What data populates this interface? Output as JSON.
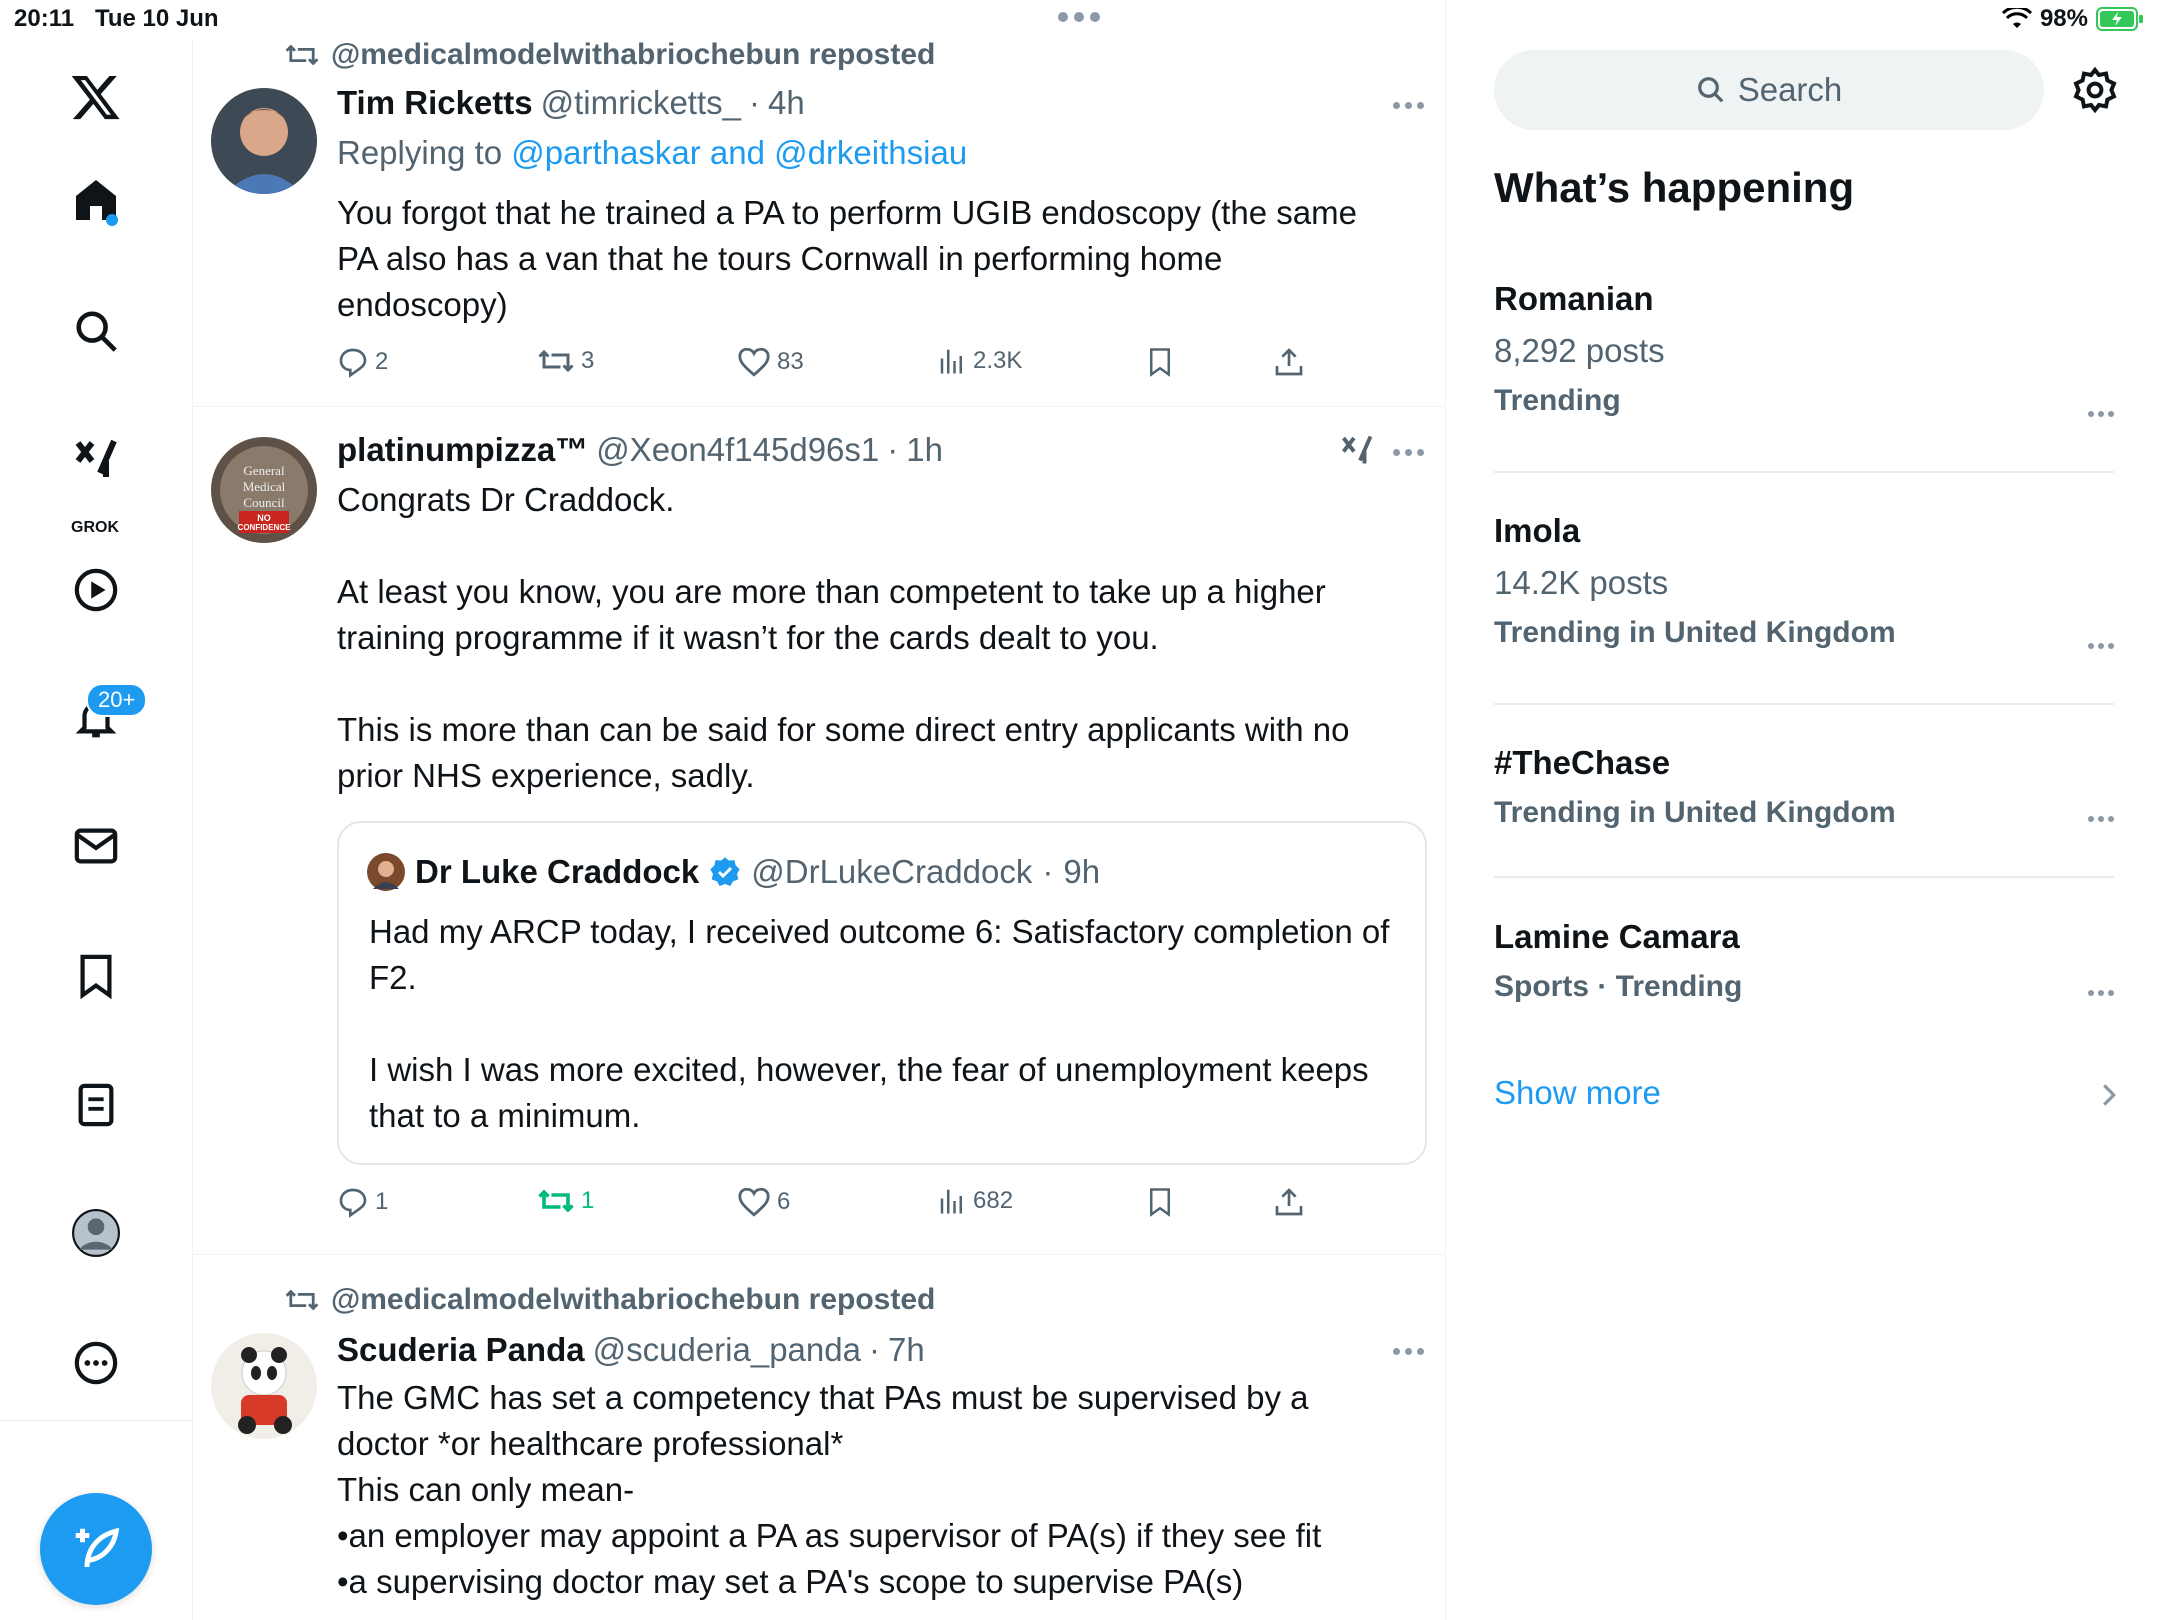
{
  "status_bar": {
    "time": "20:11",
    "date": "Tue 10 Jun",
    "battery": "98%"
  },
  "nav": {
    "grok_label": "GROK",
    "notifications_badge": "20+"
  },
  "feed": {
    "posts": [
      {
        "reposted_by": "@medicalmodelwithabriochebun reposted",
        "name": "Tim Ricketts",
        "handle": "@timricketts_",
        "sep": "·",
        "time": "4h",
        "replying_prefix": "Replying to",
        "replying_links": "@parthaskar and @drkeithsiau",
        "text": "You forgot that he trained a PA to perform UGIB endoscopy (the same PA also has a van that he tours Cornwall in performing home endoscopy)",
        "replies": "2",
        "reposts": "3",
        "likes": "83",
        "views": "2.3K"
      },
      {
        "name": "platinumpizza™",
        "handle": "@Xeon4f145d96s1",
        "sep": "·",
        "time": "1h",
        "text": "Congrats Dr Craddock.\n\nAt least you know, you are more than competent to take up a higher training programme if it wasn’t for the cards dealt to you.\n\nThis is more than can be said for some direct entry applicants with no prior NHS experience, sadly.",
        "avatar_text": "General Medical Council NO CONFIDENCE",
        "quote": {
          "name": "Dr Luke Craddock",
          "handle": "@DrLukeCraddock",
          "sep": "·",
          "time": "9h",
          "text": "Had my ARCP today, I received outcome 6: Satisfactory completion of F2.\n\nI wish I was more excited, however, the fear of unemployment keeps that to a minimum."
        },
        "replies": "1",
        "reposts": "1",
        "likes": "6",
        "views": "682"
      },
      {
        "reposted_by": "@medicalmodelwithabriochebun reposted",
        "name": "Scuderia Panda",
        "handle": "@scuderia_panda",
        "sep": "·",
        "time": "7h",
        "text": "The GMC has set a competency that PAs must be supervised by a doctor *or healthcare professional*\nThis can only mean-\n•an employer may appoint a PA as supervisor of PA(s) if they see fit\n•a supervising doctor may set a PA's scope to supervise PA(s)"
      }
    ]
  },
  "sidebar": {
    "search_placeholder": "Search",
    "heading": "What’s happening",
    "trends": [
      {
        "title": "Romanian",
        "posts": "8,292 posts",
        "context": "Trending"
      },
      {
        "title": "Imola",
        "posts": "14.2K posts",
        "context": "Trending in United Kingdom"
      },
      {
        "title": "#TheChase",
        "context": "Trending in United Kingdom"
      },
      {
        "title": "Lamine Camara",
        "context": "Sports · Trending"
      }
    ],
    "show_more": "Show more"
  },
  "colors": {
    "accent": "#1d9bf0",
    "repost_active": "#00ba7c",
    "secondary_text": "#536471"
  }
}
